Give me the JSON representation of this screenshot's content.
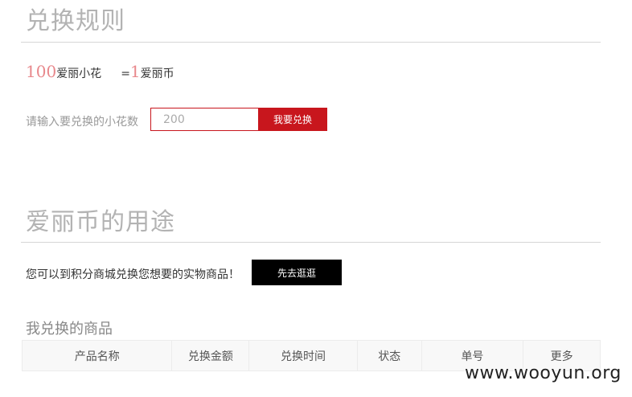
{
  "exchange": {
    "title": "兑换规则",
    "rate_flower_amount": "100",
    "rate_flower_unit": "爱丽小花",
    "rate_equals": "=",
    "rate_coin_amount": "1",
    "rate_coin_unit": "爱丽币",
    "input_label": "请输入要兑换的小花数",
    "input_placeholder": "200",
    "button_label": "我要兑换"
  },
  "usage": {
    "title": "爱丽币的用途",
    "text": "您可以到积分商城兑换您想要的实物商品！",
    "button_label": "先去逛逛"
  },
  "my_goods": {
    "title": "我兑换的商品",
    "columns": [
      "产品名称",
      "兑换金额",
      "兑换时间",
      "状态",
      "单号",
      "更多"
    ]
  },
  "watermark": "www.wooyun.org"
}
